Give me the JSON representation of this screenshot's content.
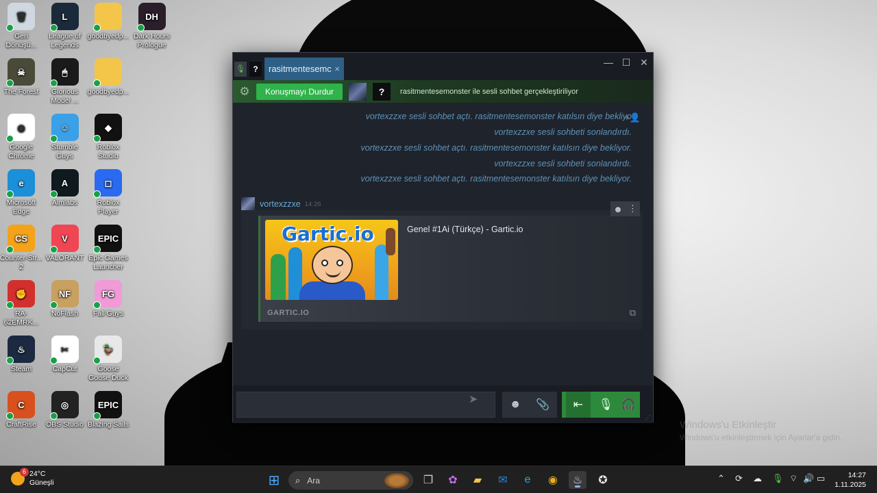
{
  "desktop_icons": [
    {
      "label": "Geri Dönüşü...",
      "color": "#cfd8e0",
      "glyph": "🗑"
    },
    {
      "label": "League of Legends",
      "color": "#1a2a3a",
      "glyph": "L"
    },
    {
      "label": "goodbyedp...",
      "color": "#f3c64a",
      "glyph": ""
    },
    {
      "label": "Dark Hours Prologue",
      "color": "#2a1e2a",
      "glyph": "DH"
    },
    {
      "label": "The Forest",
      "color": "#4a4a38",
      "glyph": "☠"
    },
    {
      "label": "Glorious Model ...",
      "color": "#1a1a1a",
      "glyph": "🖱"
    },
    {
      "label": "goodbyedp...",
      "color": "#f3c64a",
      "glyph": ""
    },
    {
      "label": "Google Chrome",
      "color": "#ffffff",
      "glyph": "◉"
    },
    {
      "label": "Stumble Guys",
      "color": "#3aa0e8",
      "glyph": "☺"
    },
    {
      "label": "Roblox Studio",
      "color": "#111111",
      "glyph": "◆"
    },
    {
      "label": "Microsoft Edge",
      "color": "#1b8fd8",
      "glyph": "e"
    },
    {
      "label": "Aimlabs",
      "color": "#0e1a1e",
      "glyph": "A"
    },
    {
      "label": "Roblox Player",
      "color": "#2a6af0",
      "glyph": "◻"
    },
    {
      "label": "Counter-Str... 2",
      "color": "#f3a21a",
      "glyph": "CS"
    },
    {
      "label": "VALORANT",
      "color": "#f04653",
      "glyph": "V"
    },
    {
      "label": "Epic Games Launcher",
      "color": "#111111",
      "glyph": "EPIC"
    },
    {
      "label": "RA-62EMRK...",
      "color": "#d32f2f",
      "glyph": "✊"
    },
    {
      "label": "NoFlash",
      "color": "#c8a060",
      "glyph": "NF"
    },
    {
      "label": "Fall Guys",
      "color": "#f09ad8",
      "glyph": "FG"
    },
    {
      "label": "Steam",
      "color": "#1b2a40",
      "glyph": "♨"
    },
    {
      "label": "CapCut",
      "color": "#ffffff",
      "glyph": "✂"
    },
    {
      "label": "Goose Goose Duck",
      "color": "#e8e8e8",
      "glyph": "🦆"
    },
    {
      "label": "CraftRise",
      "color": "#d8501e",
      "glyph": "C"
    },
    {
      "label": "OBS Studio",
      "color": "#222222",
      "glyph": "◎"
    },
    {
      "label": "Blazing Sails",
      "color": "#111111",
      "glyph": "EPIC"
    }
  ],
  "chat_window": {
    "tab_title": "rasitmentesemc",
    "tab_close": "×",
    "tab_question": "?",
    "controls": {
      "minimize": "—",
      "maximize": "☐",
      "close": "✕"
    },
    "voice_bar": {
      "stop_button": "Konuşmayı Durdur",
      "question": "?",
      "status": "rasitmentesemonster ile sesli sohbet gerçekleştiriliyor"
    },
    "system_messages": [
      "vortexzzxe sesli sohbet açtı. rasitmentesemonster katılsın diye bekliyo",
      "vortexzzxe sesli sohbeti sonlandırdı.",
      "vortexzzxe sesli sohbet açtı. rasitmentesemonster katılsın diye bekliyor.",
      "vortexzzxe sesli sohbeti sonlandırdı.",
      "vortexzzxe sesli sohbet açtı. rasitmentesemonster katılsın diye bekliyor."
    ],
    "message": {
      "author": "vortexzzxe",
      "time": "14:26",
      "embed": {
        "logo": "Gartic.io",
        "title": "Genel #1Ai (Türkçe) - Gartic.io",
        "site": "GARTIC.IO"
      }
    }
  },
  "taskbar": {
    "weather": {
      "temp": "24°C",
      "condition": "Güneşli",
      "badge": "6"
    },
    "search_placeholder": "Ara",
    "clock_time": "14:27",
    "clock_date": "1.11.2025"
  },
  "watermark": {
    "line1": "Windows'u Etkinleştir",
    "line2": "Windows'u etkinleştirmek için Ayarlar'a gidin."
  }
}
